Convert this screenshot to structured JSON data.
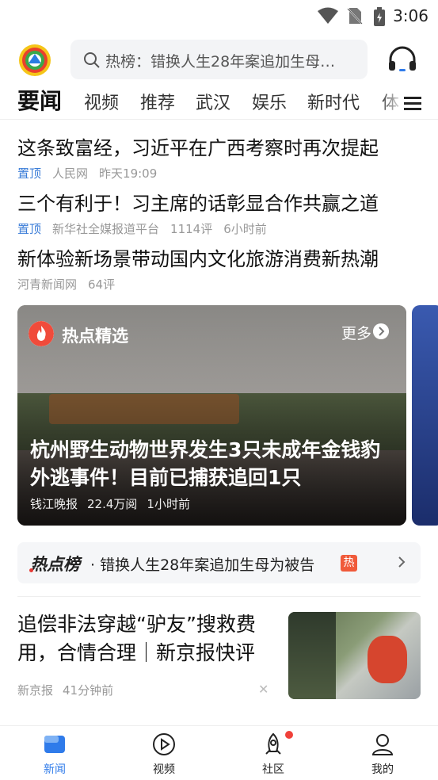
{
  "status_bar": {
    "time": "3:06"
  },
  "header": {
    "search_placeholder": "热榜：错换人生28年案追加生母…"
  },
  "tabs": [
    "要闻",
    "视频",
    "推荐",
    "武汉",
    "娱乐",
    "新时代",
    "体"
  ],
  "top_news": [
    {
      "title": "这条致富经，习近平在广西考察时再次提起",
      "pin": "置顶",
      "source": "人民网",
      "time": "昨天19:09",
      "comments": ""
    },
    {
      "title": "三个有利于！习主席的话彰显合作共赢之道",
      "pin": "置顶",
      "source": "新华社全媒报道平台",
      "comments": "1114评",
      "time": "6小时前"
    },
    {
      "title": "新体验新场景带动国内文化旅游消费新热潮",
      "pin": "",
      "source": "河青新闻网",
      "comments": "64评",
      "time": ""
    }
  ],
  "hot_card": {
    "label": "热点精选",
    "more": "更多",
    "title": "杭州野生动物世界发生3只未成年金钱豹外逃事件！目前已捕获追回1只",
    "source": "钱江晚报",
    "views": "22.4万阅",
    "time": "1小时前"
  },
  "hot_list": {
    "label": "热点榜",
    "text": "· 错换人生28年案追加生母为被告",
    "badge": "热"
  },
  "article": {
    "title": "追偿非法穿越“驴友”搜救费用，合情合理｜新京报快评",
    "source": "新京报",
    "time": "41分钟前"
  },
  "bottom_nav": [
    {
      "label": "新闻"
    },
    {
      "label": "视频"
    },
    {
      "label": "社区"
    },
    {
      "label": "我的"
    }
  ],
  "colors": {
    "accent": "#2f7bea",
    "pin": "#3b7dd8",
    "hot": "#f05a3a"
  }
}
